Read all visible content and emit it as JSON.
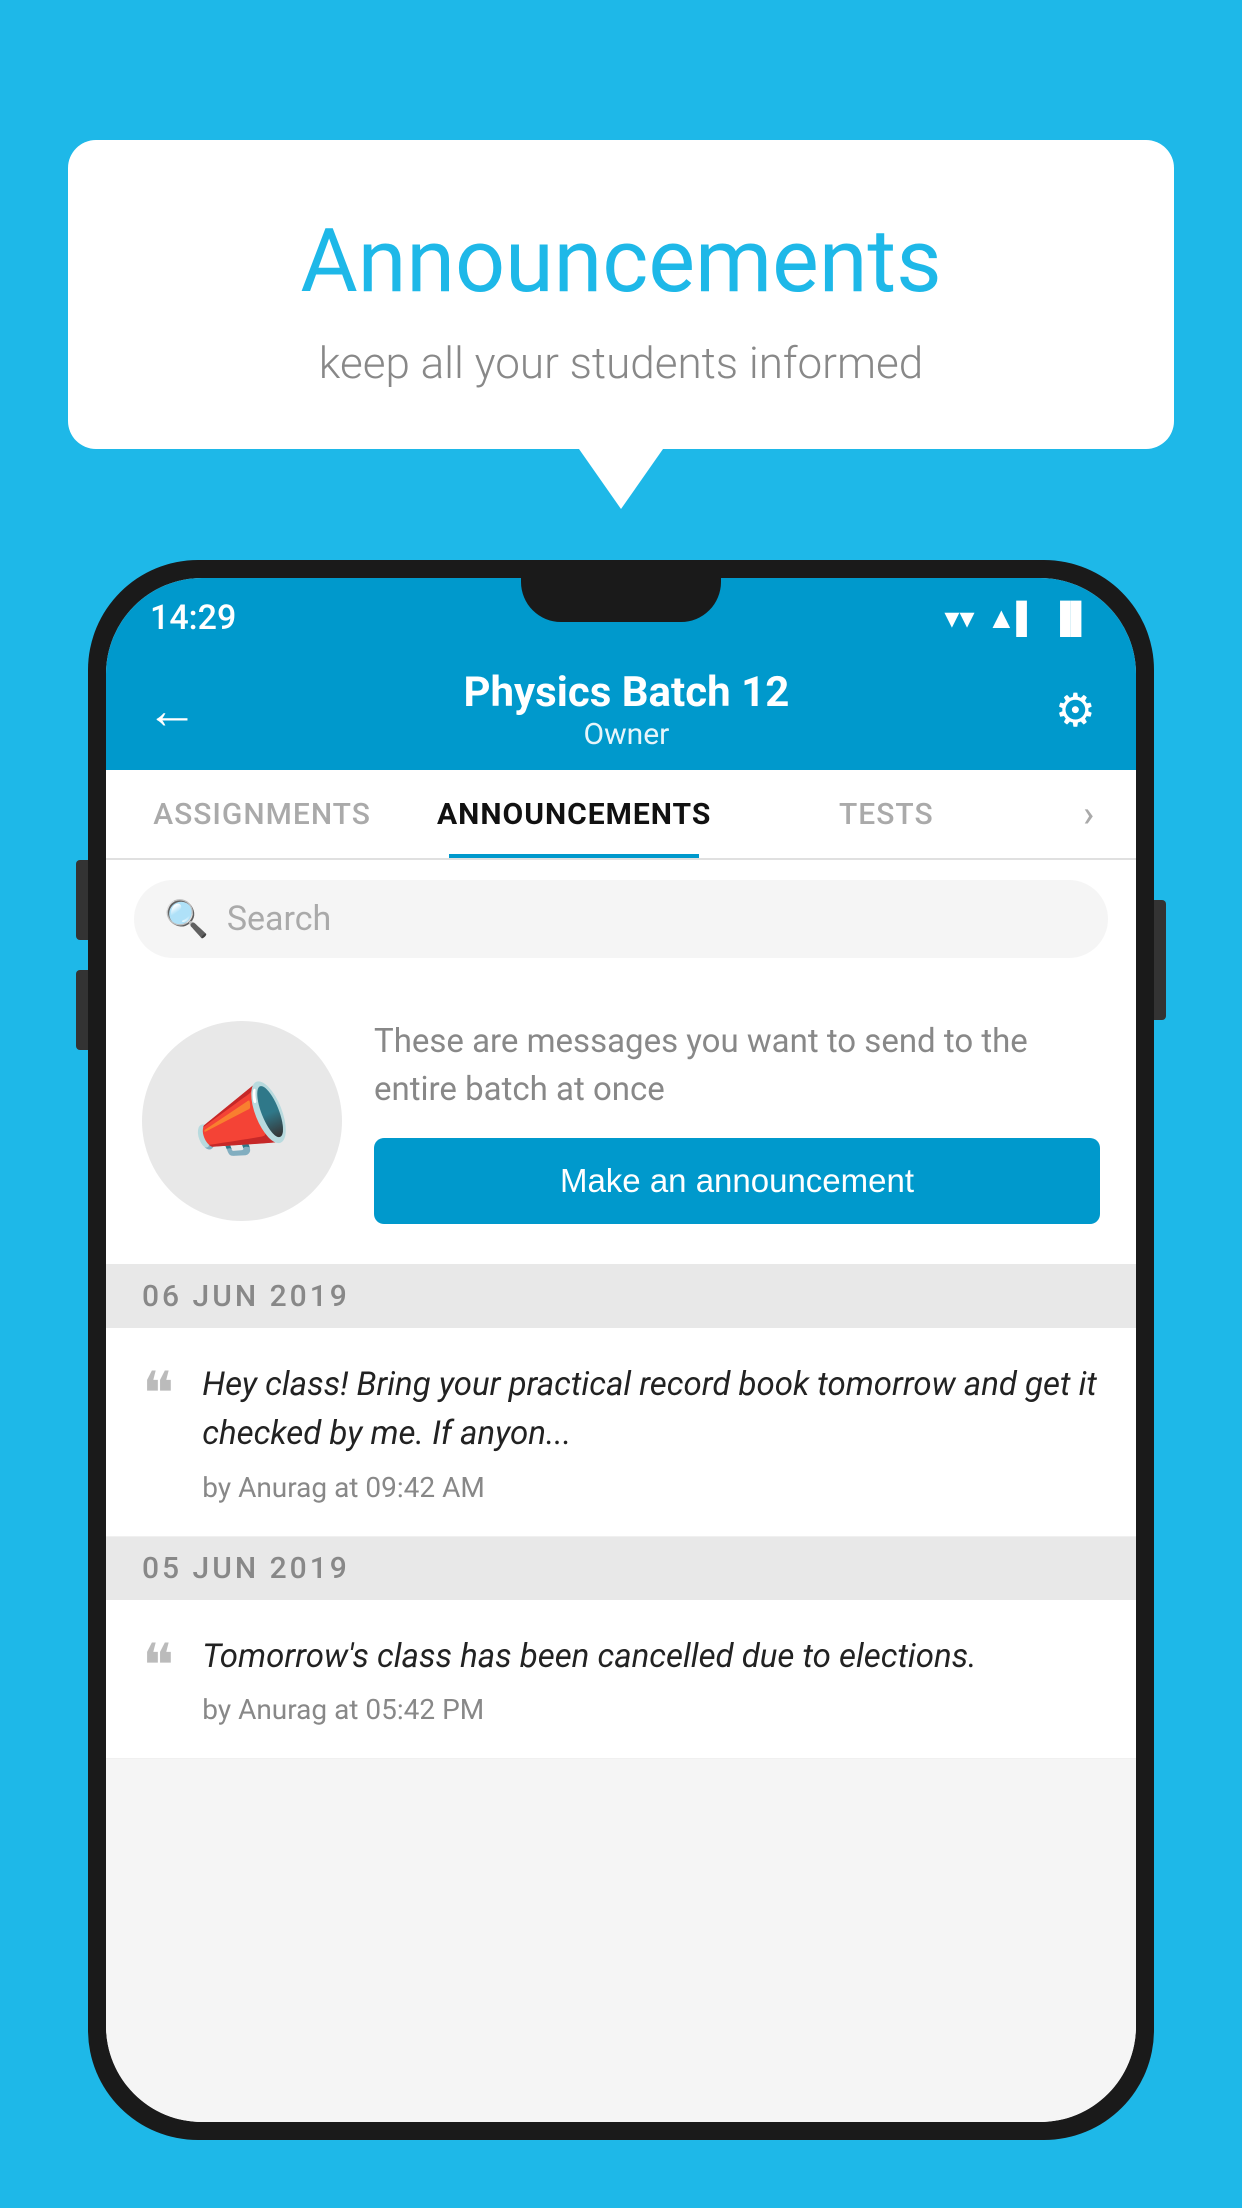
{
  "background_color": "#1eb8e8",
  "speech_bubble": {
    "title": "Announcements",
    "subtitle": "keep all your students informed"
  },
  "phone": {
    "status_bar": {
      "time": "14:29",
      "wifi_icon": "▼",
      "signal_icon": "▲",
      "battery_icon": "▐"
    },
    "app_bar": {
      "back_label": "←",
      "title": "Physics Batch 12",
      "subtitle": "Owner",
      "settings_icon": "⚙"
    },
    "tabs": [
      {
        "label": "ASSIGNMENTS",
        "active": false
      },
      {
        "label": "ANNOUNCEMENTS",
        "active": true
      },
      {
        "label": "TESTS",
        "active": false
      },
      {
        "label": "›",
        "active": false
      }
    ],
    "search": {
      "placeholder": "Search"
    },
    "promo": {
      "description": "These are messages you want to send to the entire batch at once",
      "button_label": "Make an announcement"
    },
    "announcements": [
      {
        "date_separator": "06  JUN  2019",
        "text": "Hey class! Bring your practical record book tomorrow and get it checked by me. If anyon...",
        "meta": "by Anurag at 09:42 AM"
      },
      {
        "date_separator": "05  JUN  2019",
        "text": "Tomorrow's class has been cancelled due to elections.",
        "meta": "by Anurag at 05:42 PM"
      }
    ]
  }
}
